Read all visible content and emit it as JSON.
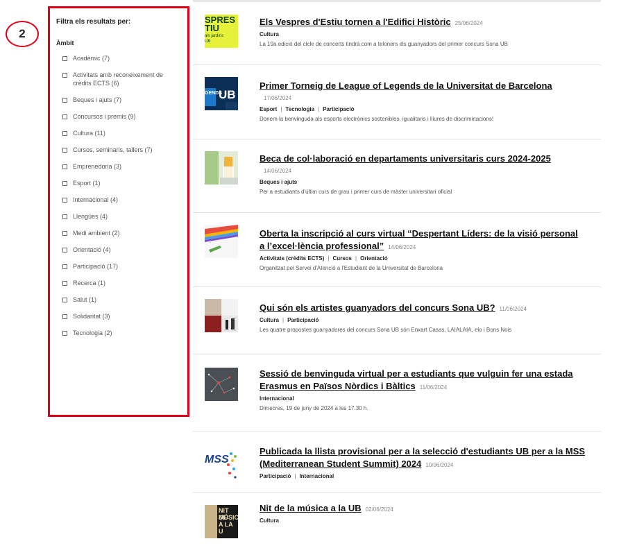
{
  "annotation": {
    "step_number": "2"
  },
  "filters": {
    "title": "Filtra els resultats per:",
    "section": "Àmbit",
    "items": [
      "Acadèmic (7)",
      "Activitats amb reconeixement de crèdits ECTS (6)",
      "Beques i ajuts (7)",
      "Concursos i premis (9)",
      "Cultura (11)",
      "Cursos, seminaris, tallers (7)",
      "Emprenedoria (3)",
      "Esport (1)",
      "Internacional (4)",
      "Llengües (4)",
      "Medi ambient (2)",
      "Orientació (4)",
      "Participació (17)",
      "Recerca (1)",
      "Salut (1)",
      "Solidaritat (3)",
      "Tecnologia (2)"
    ]
  },
  "articles": [
    {
      "title": "Els Vespres d'Estiu tornen a l'Edifici Històric",
      "date": "25/06/2024",
      "tags": [
        "Cultura"
      ],
      "description": "La 19a edició del cicle de concerts tindrà com a teloners els guanyadors del primer concurs Sona UB",
      "thumb_text": [
        "SPRES",
        "TIU",
        "als jardins",
        "UB"
      ]
    },
    {
      "title": "Primer Torneig de League of Legends de la Universitat de Barcelona",
      "date": "17/06/2024",
      "tags": [
        "Esport",
        "Tecnologia",
        "Participació"
      ],
      "description": "Donem la benvinguda als esports electrònics sostenibles, igualitaris i lliures de discriminacions!",
      "thumb_text": [
        "UB",
        "GENDS"
      ]
    },
    {
      "title": "Beca de col·laboració en departaments universitaris curs 2024-2025",
      "date": "14/06/2024",
      "tags": [
        "Beques i ajuts"
      ],
      "description": "Per a estudiants d'últim curs de grau i primer curs de màster universitari oficial"
    },
    {
      "title": "Oberta la inscripció al curs virtual  “Despertant  Líders: de la visió personal a l’excel·lència professional”",
      "date": "14/06/2024",
      "tags": [
        "Activitats (crèdits ECTS)",
        "Cursos",
        "Orientació"
      ],
      "description": "Organitzat pel Servei d'Atenció a l'Estudiant de la Universitat de Barcelona"
    },
    {
      "title": "Qui són els artistes guanyadors del concurs Sona UB?",
      "date": "11/06/2024",
      "tags": [
        "Cultura",
        "Participació"
      ],
      "description": "Les quatre propostes guanyadores del concurs Sona UB són Enxart Casas, LAIALAIA, elo i Bons Nois"
    },
    {
      "title": "Sessió de benvinguda virtual per a estudiants que vulguin fer una estada Erasmus en Països Nòrdics i Bàltics",
      "date": "11/06/2024",
      "tags": [
        "Internacional"
      ],
      "description": "Dimecres, 19 de juny de 2024 a les 17.30 h."
    },
    {
      "title": "Publicada la llista provisional per a la selecció d'estudiants UB per a la MSS (Mediterranean Student Summit) 2024",
      "date": "10/06/2024",
      "tags": [
        "Participació",
        "Internacional"
      ],
      "thumb_text": [
        "MSS"
      ]
    },
    {
      "title": "Nit de la música a la UB",
      "date": "02/06/2024",
      "tags": [
        "Cultura"
      ],
      "thumb_text": [
        "NIT DE",
        "MÚSICA",
        "A LA U"
      ]
    }
  ]
}
